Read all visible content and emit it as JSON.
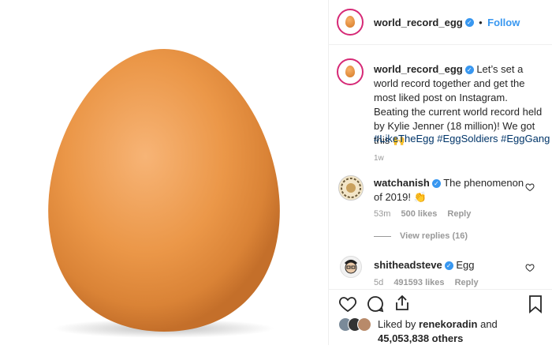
{
  "post": {
    "author": "world_record_egg",
    "follow_label": "Follow",
    "dot": "•",
    "caption": "Let’s set a world record together and get the most liked post on Instagram. Beating the current world record held by Kylie Jenner (18 million)! We got this 🙌",
    "hashtags": "#LikeTheEgg #EggSoldiers #EggGang",
    "time": "1w"
  },
  "comments": [
    {
      "user": "watchanish",
      "text": "The phenomenon of 2019! 👏",
      "time": "53m",
      "likes": "500 likes",
      "reply": "Reply",
      "view_replies": "View replies (16)"
    },
    {
      "user": "shitheadsteve",
      "text": "Egg",
      "time": "5d",
      "likes": "491593 likes",
      "reply": "Reply"
    }
  ],
  "likes": {
    "prefix": "Liked by",
    "user": "renekoradin",
    "and": "and",
    "count": "45,053,838 others"
  },
  "icons": [
    "heart-icon",
    "comment-icon",
    "share-icon",
    "bookmark-icon",
    "verified-badge-icon"
  ],
  "colors": {
    "accent": "#3897f0",
    "ring": "#d62976",
    "egg": "#e08a3a"
  }
}
